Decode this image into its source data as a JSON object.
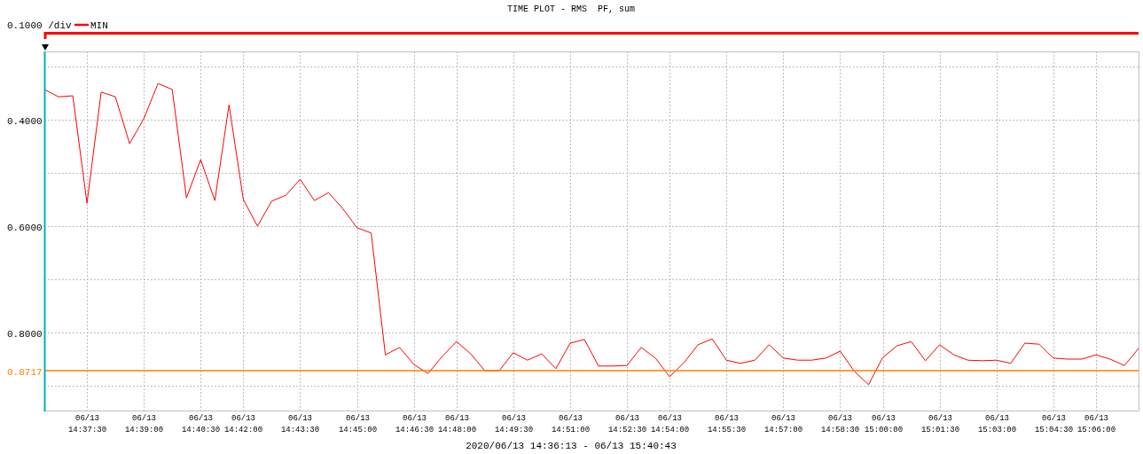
{
  "title": "TIME PLOT - RMS  PF, sum",
  "scale": "0.1000 /div",
  "chart_data": {
    "type": "line",
    "grid": true,
    "categories": [
      null,
      null,
      null,
      "06/13 14:37:30",
      null,
      null,
      null,
      "06/13 14:39:00",
      null,
      null,
      null,
      "06/13 14:40:30",
      null,
      null,
      "06/13 14:42:00",
      null,
      null,
      null,
      "06/13 14:43:30",
      null,
      null,
      null,
      "06/13 14:45:00",
      null,
      null,
      null,
      "06/13 14:46:30",
      null,
      null,
      "06/13 14:48:00",
      null,
      null,
      null,
      "06/13 14:49:30",
      null,
      null,
      null,
      "06/13 14:51:00",
      null,
      null,
      null,
      "06/13 14:52:30",
      null,
      null,
      "06/13 14:54:00",
      null,
      null,
      null,
      "06/13 14:55:30",
      null,
      null,
      null,
      "06/13 14:57:00",
      null,
      null,
      null,
      "06/13 14:58:30",
      null,
      null,
      "06/13 15:00:00",
      null,
      null,
      null,
      "06/13 15:01:30",
      null,
      null,
      null,
      "06/13 15:03:00",
      null,
      null,
      null,
      "06/13 15:04:30",
      null,
      null,
      "06/13 15:06:00",
      null,
      null,
      null
    ],
    "series": [
      {
        "name": "MIN",
        "color": "#ff0000",
        "values": [
          0.343,
          0.357,
          0.355,
          0.557,
          0.348,
          0.357,
          0.445,
          0.398,
          0.332,
          0.343,
          0.547,
          0.475,
          0.552,
          0.372,
          0.55,
          0.6,
          0.553,
          0.542,
          0.512,
          0.552,
          0.537,
          0.567,
          0.603,
          0.613,
          0.842,
          0.828,
          0.86,
          0.877,
          0.845,
          0.817,
          0.84,
          0.872,
          0.872,
          0.838,
          0.852,
          0.84,
          0.868,
          0.82,
          0.813,
          0.863,
          0.863,
          0.862,
          0.828,
          0.848,
          0.883,
          0.857,
          0.823,
          0.812,
          0.852,
          0.858,
          0.852,
          0.823,
          0.848,
          0.852,
          0.852,
          0.848,
          0.835,
          0.873,
          0.898,
          0.847,
          0.825,
          0.817,
          0.853,
          0.823,
          0.842,
          0.852,
          0.853,
          0.852,
          0.858,
          0.82,
          0.822,
          0.848,
          0.85,
          0.85,
          0.842,
          0.85,
          0.862,
          0.83
        ]
      },
      {
        "color": "#ff8000",
        "values": [
          0.8717,
          0.8717,
          0.8717,
          0.8717,
          0.8717,
          0.8717,
          0.8717,
          0.8717,
          0.8717,
          0.8717,
          0.8717,
          0.8717,
          0.8717,
          0.8717,
          0.8717,
          0.8717,
          0.8717,
          0.8717,
          0.8717,
          0.8717,
          0.8717,
          0.8717,
          0.8717,
          0.8717,
          0.8717,
          0.8717,
          0.8717,
          0.8717,
          0.8717,
          0.8717,
          0.8717,
          0.8717,
          0.8717,
          0.8717,
          0.8717,
          0.8717,
          0.8717,
          0.8717,
          0.8717,
          0.8717,
          0.8717,
          0.8717,
          0.8717,
          0.8717,
          0.8717,
          0.8717,
          0.8717,
          0.8717,
          0.8717,
          0.8717,
          0.8717,
          0.8717,
          0.8717,
          0.8717,
          0.8717,
          0.8717,
          0.8717,
          0.8717,
          0.8717,
          0.8717,
          0.8717,
          0.8717,
          0.8717,
          0.8717,
          0.8717,
          0.8717,
          0.8717,
          0.8717,
          0.8717,
          0.8717,
          0.8717,
          0.8717,
          0.8717,
          0.8717,
          0.8717,
          0.8717,
          0.8717,
          0.8717
        ]
      }
    ],
    "ylim": [
      0.9467,
      0.2717
    ],
    "yticks": [
      {
        "value": 0.4,
        "label": "0.4000"
      },
      {
        "value": 0.6,
        "label": "0.6000"
      },
      {
        "value": 0.8,
        "label": "0.8000"
      },
      {
        "value": 0.8717,
        "label": "0.8717"
      }
    ]
  },
  "range_label": "2020/06/13 14:36:13 - 06/13 15:40:43"
}
